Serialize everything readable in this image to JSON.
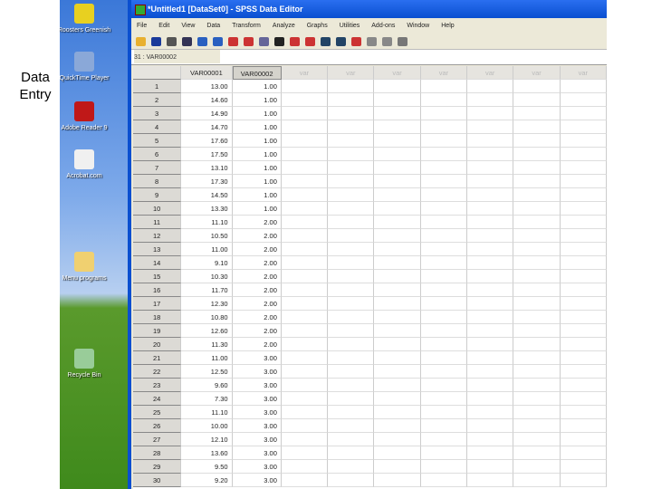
{
  "slide_label": "Data Entry",
  "desktop_icons": [
    {
      "label": "Roosters Greenish",
      "color": "#e8d020"
    },
    {
      "label": "QuickTime Player",
      "color": "#8aa8d8"
    },
    {
      "label": "Adobe Reader 9",
      "color": "#c01818"
    },
    {
      "label": "Acrobat.com",
      "color": "#f0f0f0"
    },
    {
      "label": "Menu programs",
      "color": "#f0d070"
    },
    {
      "label": "Recycle Bin",
      "color": "#9c9"
    }
  ],
  "window": {
    "title": "*Untitled1 [DataSet0] - SPSS Data Editor"
  },
  "menu": [
    "File",
    "Edit",
    "View",
    "Data",
    "Transform",
    "Analyze",
    "Graphs",
    "Utilities",
    "Add-ons",
    "Window",
    "Help"
  ],
  "cell_editor": {
    "ref": "31 : VAR00002"
  },
  "columns": [
    "VAR00001",
    "VAR00002",
    "var",
    "var",
    "var",
    "var",
    "var",
    "var",
    "var"
  ],
  "rows": [
    [
      "1",
      "13.00",
      "1.00"
    ],
    [
      "2",
      "14.60",
      "1.00"
    ],
    [
      "3",
      "14.90",
      "1.00"
    ],
    [
      "4",
      "14.70",
      "1.00"
    ],
    [
      "5",
      "17.60",
      "1.00"
    ],
    [
      "6",
      "17.50",
      "1.00"
    ],
    [
      "7",
      "13.10",
      "1.00"
    ],
    [
      "8",
      "17.30",
      "1.00"
    ],
    [
      "9",
      "14.50",
      "1.00"
    ],
    [
      "10",
      "13.30",
      "1.00"
    ],
    [
      "11",
      "11.10",
      "2.00"
    ],
    [
      "12",
      "10.50",
      "2.00"
    ],
    [
      "13",
      "11.00",
      "2.00"
    ],
    [
      "14",
      "9.10",
      "2.00"
    ],
    [
      "15",
      "10.30",
      "2.00"
    ],
    [
      "16",
      "11.70",
      "2.00"
    ],
    [
      "17",
      "12.30",
      "2.00"
    ],
    [
      "18",
      "10.80",
      "2.00"
    ],
    [
      "19",
      "12.60",
      "2.00"
    ],
    [
      "20",
      "11.30",
      "2.00"
    ],
    [
      "21",
      "11.00",
      "3.00"
    ],
    [
      "22",
      "12.50",
      "3.00"
    ],
    [
      "23",
      "9.60",
      "3.00"
    ],
    [
      "24",
      "7.30",
      "3.00"
    ],
    [
      "25",
      "11.10",
      "3.00"
    ],
    [
      "26",
      "10.00",
      "3.00"
    ],
    [
      "27",
      "12.10",
      "3.00"
    ],
    [
      "28",
      "13.60",
      "3.00"
    ],
    [
      "29",
      "9.50",
      "3.00"
    ],
    [
      "30",
      "9.20",
      "3.00"
    ]
  ]
}
